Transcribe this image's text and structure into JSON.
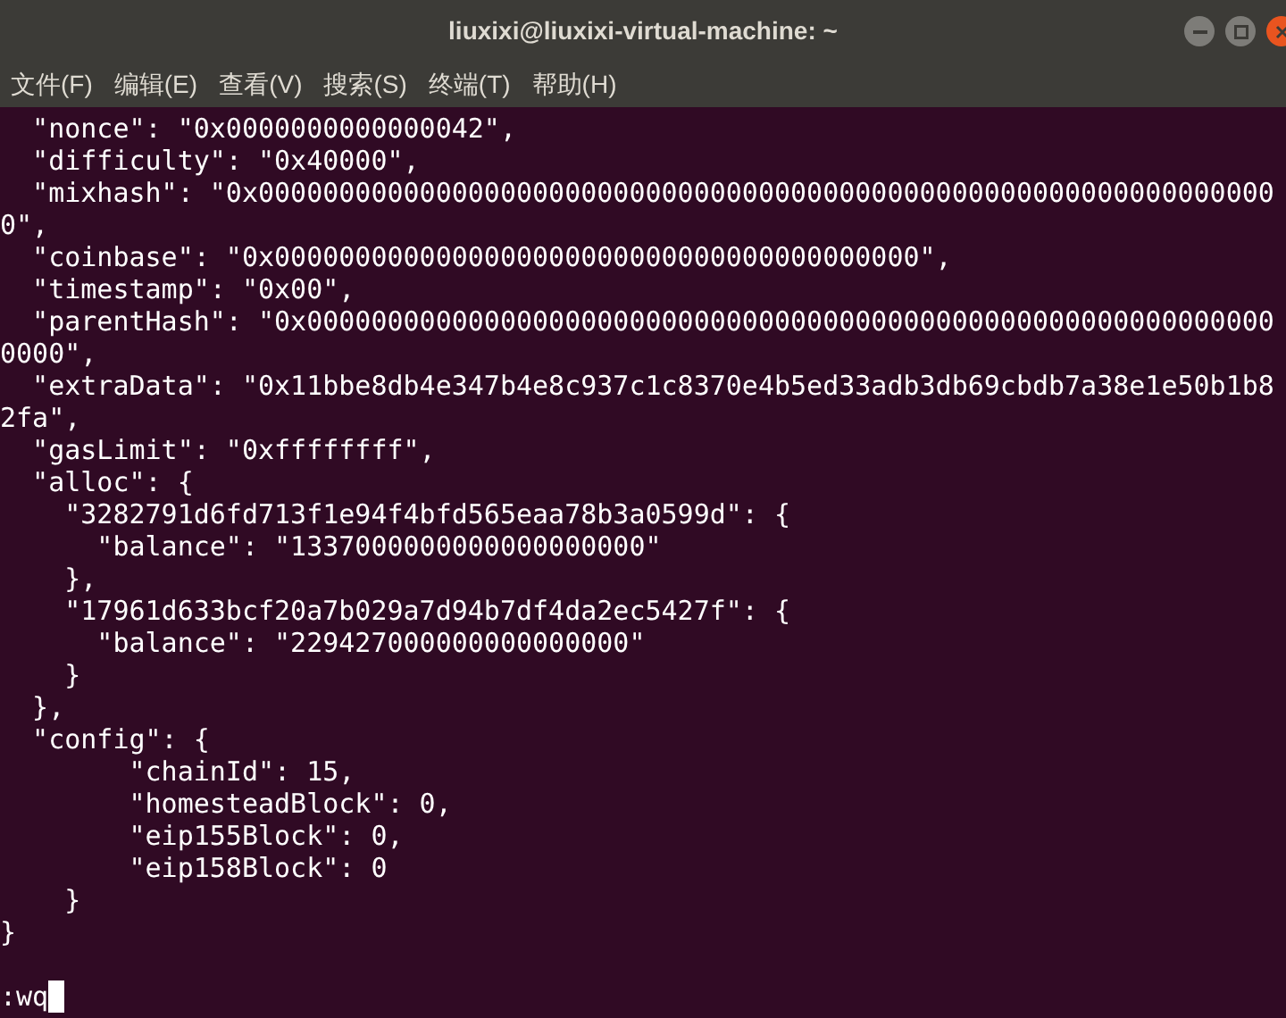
{
  "window": {
    "title": "liuxixi@liuxixi-virtual-machine: ~"
  },
  "menu": [
    "文件(F)",
    "编辑(E)",
    "查看(V)",
    "搜索(S)",
    "终端(T)",
    "帮助(H)"
  ],
  "lines": [
    "  \"nonce\": \"0x0000000000000042\",",
    "  \"difficulty\": \"0x40000\",",
    "  \"mixhash\": \"0x000000000000000000000000000000000000000000000000000000000000000",
    "0\",",
    "  \"coinbase\": \"0x0000000000000000000000000000000000000000\",",
    "  \"timestamp\": \"0x00\",",
    "  \"parentHash\": \"0x000000000000000000000000000000000000000000000000000000000000",
    "0000\",",
    "  \"extraData\": \"0x11bbe8db4e347b4e8c937c1c8370e4b5ed33adb3db69cbdb7a38e1e50b1b8",
    "2fa\",",
    "  \"gasLimit\": \"0xffffffff\",",
    "  \"alloc\": {",
    "    \"3282791d6fd713f1e94f4bfd565eaa78b3a0599d\": {",
    "      \"balance\": \"1337000000000000000000\"",
    "    },",
    "    \"17961d633bcf20a7b029a7d94b7df4da2ec5427f\": {",
    "      \"balance\": \"229427000000000000000\"",
    "    }",
    "  },",
    "  \"config\": {",
    "        \"chainId\": 15,",
    "        \"homesteadBlock\": 0,",
    "        \"eip155Block\": 0,",
    "        \"eip158Block\": 0",
    "    }",
    "}"
  ],
  "command_line": ":wq"
}
